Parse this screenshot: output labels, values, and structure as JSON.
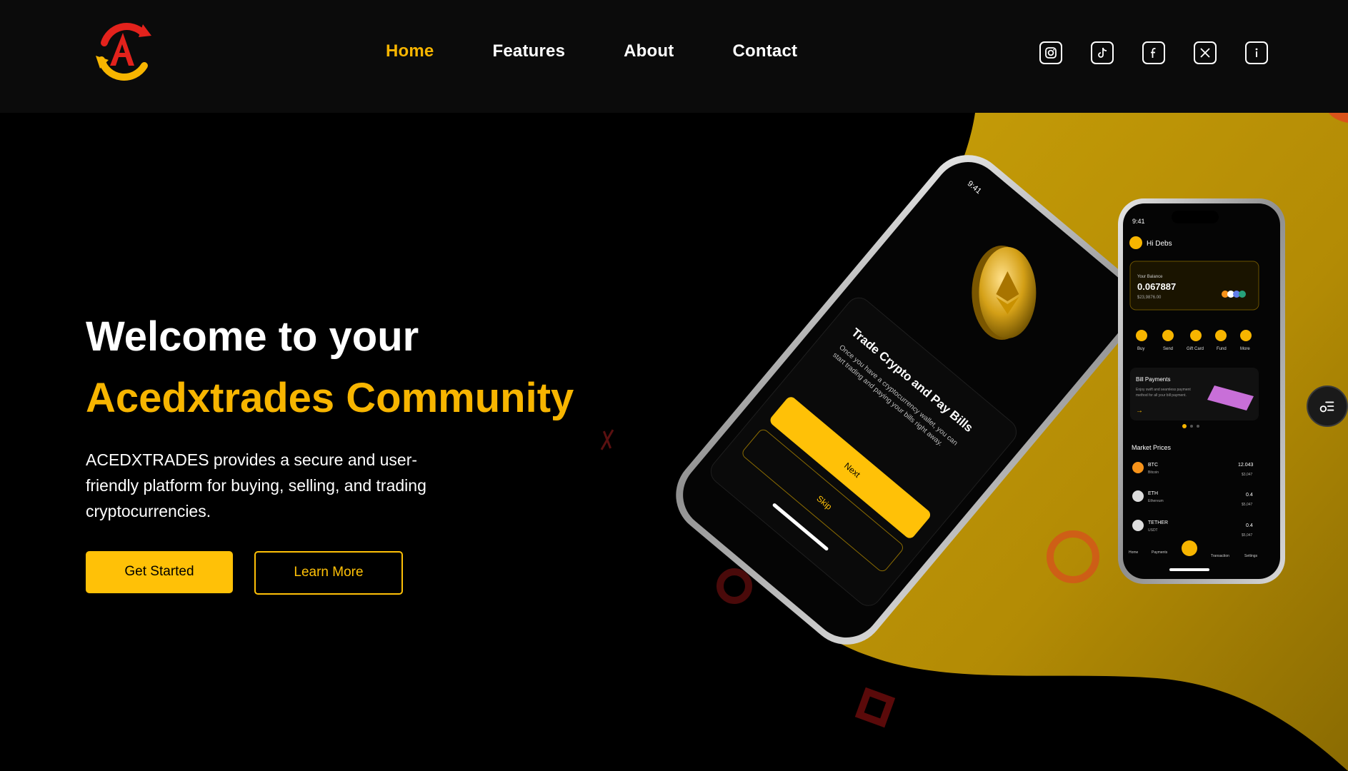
{
  "brand": {
    "logo_icon": "acedxtrades-logo",
    "colors": {
      "accent": "#f7b500",
      "red": "#e3221c",
      "gold": "#c39a06"
    }
  },
  "nav": {
    "items": [
      {
        "label": "Home",
        "active": true
      },
      {
        "label": "Features",
        "active": false
      },
      {
        "label": "About",
        "active": false
      },
      {
        "label": "Contact",
        "active": false
      }
    ]
  },
  "social": [
    "instagram-icon",
    "tiktok-icon",
    "facebook-icon",
    "x-icon",
    "info-icon"
  ],
  "hero": {
    "title_line1": "Welcome to your",
    "title_line2": "Acedxtrades Community",
    "description": "ACEDXTRADES provides a secure and user-friendly platform for buying, selling, and trading cryptocurrencies.",
    "cta_primary": "Get Started",
    "cta_secondary": "Learn More"
  },
  "phone_left": {
    "time": "9:41",
    "headline": "Trade Crypto and Pay Bills",
    "body": "Once you have a cryptocurrency wallet, you can start trading and paying your bills right away.",
    "next": "Next",
    "skip": "Skip"
  },
  "phone_right": {
    "time": "9:41",
    "greeting": "Hi Debs",
    "balance_label": "Your Balance",
    "balance": "0.067887",
    "balance_fiat": "$23,9876.00",
    "actions": [
      "Buy",
      "Send",
      "Gift Card",
      "Fund",
      "More"
    ],
    "bill_title": "Bill Payments",
    "bill_text": "Enjoy swift and seamless payment method for all your bill payment.",
    "market_title": "Market Prices",
    "market": [
      {
        "sym": "BTC",
        "name": "Bitcoin",
        "val": "12.043",
        "sub": "$3,047"
      },
      {
        "sym": "ETH",
        "name": "Ethereum",
        "val": "0.4",
        "sub": "$5,047"
      },
      {
        "sym": "TETHER",
        "name": "USDT",
        "val": "0.4",
        "sub": "$5,047"
      }
    ],
    "tabs": [
      "Home",
      "Payments",
      "",
      "Transaction",
      "Settings"
    ]
  }
}
